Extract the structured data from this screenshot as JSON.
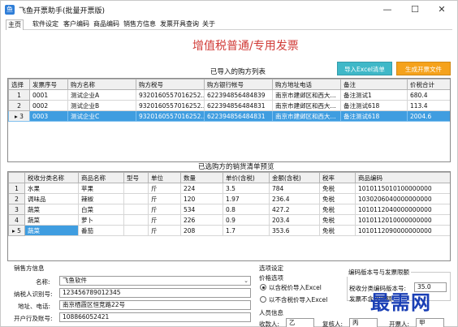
{
  "window": {
    "title": "飞鱼开票助手(批量开票版)",
    "minimize_glyph": "—",
    "maximize_glyph": "☐",
    "close_glyph": "✕"
  },
  "menu": [
    "主页",
    "软件设定",
    "客户编码",
    "商品编码",
    "销售方信息",
    "发票开具查询",
    "关于"
  ],
  "page_title": "增值税普通/专用发票",
  "buyers": {
    "title": "已导入的购方列表",
    "import_button": "导入Excel清单",
    "generate_button": "生成开票文件",
    "columns": [
      "选择",
      "发票序号",
      "购方名称",
      "购方税号",
      "购方银行帐号",
      "购方地址电话",
      "备注",
      "价税合计"
    ],
    "rows": [
      {
        "marker": "1",
        "seq": "0001",
        "name": "测试企业A",
        "taxid": "932016055701625​2...",
        "bank": "622394856484839",
        "addr": "南京市建邺区和西大...",
        "note": "备注测试1",
        "total": "680.4"
      },
      {
        "marker": "2",
        "seq": "0002",
        "name": "测试企业B",
        "taxid": "9320160557016252...",
        "bank": "622394856484831",
        "addr": "南京市建邺区和西大...",
        "note": "备注测试618",
        "total": "113.4"
      },
      {
        "marker": "▸ 3",
        "seq": "0003",
        "name": "测试企业C",
        "taxid": "9320160557016252...",
        "bank": "622394856484831",
        "addr": "南京市建邺区和西大...",
        "note": "备注测试618",
        "total": "2004.6"
      }
    ]
  },
  "goods": {
    "title": "已选购方的销货清单预览",
    "columns": [
      "",
      "税收分类名称",
      "商品名称",
      "型号",
      "单位",
      "数量",
      "单价(含税)",
      "金额(含税)",
      "税率",
      "商品编码"
    ],
    "rows": [
      {
        "marker": "1",
        "cat": "水果",
        "name": "苹果",
        "model": "",
        "unit": "斤",
        "qty": "224",
        "price": "3.5",
        "amount": "784",
        "rate": "免税",
        "code": "1010115010100000000"
      },
      {
        "marker": "2",
        "cat": "调味品",
        "name": "辣椒",
        "model": "",
        "unit": "斤",
        "qty": "120",
        "price": "1.97",
        "amount": "236.4",
        "rate": "免税",
        "code": "1030206040000000000"
      },
      {
        "marker": "3",
        "cat": "蔬菜",
        "name": "白菜",
        "model": "",
        "unit": "斤",
        "qty": "534",
        "price": "0.8",
        "amount": "427.2",
        "rate": "免税",
        "code": "1010112040000000000"
      },
      {
        "marker": "4",
        "cat": "蔬菜",
        "name": "萝卜",
        "model": "",
        "unit": "斤",
        "qty": "226",
        "price": "0.9",
        "amount": "203.4",
        "rate": "免税",
        "code": "1010112010000000000"
      },
      {
        "marker": "▸ 5",
        "cat": "蔬菜",
        "name": "番茄",
        "model": "",
        "unit": "斤",
        "qty": "208",
        "price": "1.7",
        "amount": "353.6",
        "rate": "免税",
        "code": "1010112090000000000"
      }
    ]
  },
  "seller": {
    "group_title": "销售方信息",
    "name_label": "名称:",
    "name_value": "飞鱼软件",
    "taxid_label": "纳税人识别号:",
    "taxid_value": "123456789012345",
    "addr_label": "地址、电话:",
    "addr_value": "南京栖霞区恒竞路22号",
    "bank_label": "开户行及账号:",
    "bank_value": "108866052421"
  },
  "options": {
    "group_title": "选项设定",
    "price_title": "价格选项",
    "radio_incl": "以含税价导入Excel",
    "radio_excl": "以不含税价导入Excel",
    "version_title": "编码版本号与发票限额",
    "version_label": "税收分类编码版本号:",
    "version_value": "35.0",
    "limit_label": "发票不含税限额",
    "people_title": "人员信息",
    "payee_label": "收款人:",
    "payee_value": "乙",
    "reviewer_label": "复核人:",
    "reviewer_value": "丙",
    "drawer_label": "开票人:",
    "drawer_value": "甲"
  },
  "watermark": "最需网",
  "colors": {
    "title_red": "#d13c38",
    "import_btn": "#3fb8c8",
    "generate_btn": "#f5a21c",
    "selected_row": "#3f9de0",
    "watermark_blue": "#1a3fb5"
  }
}
